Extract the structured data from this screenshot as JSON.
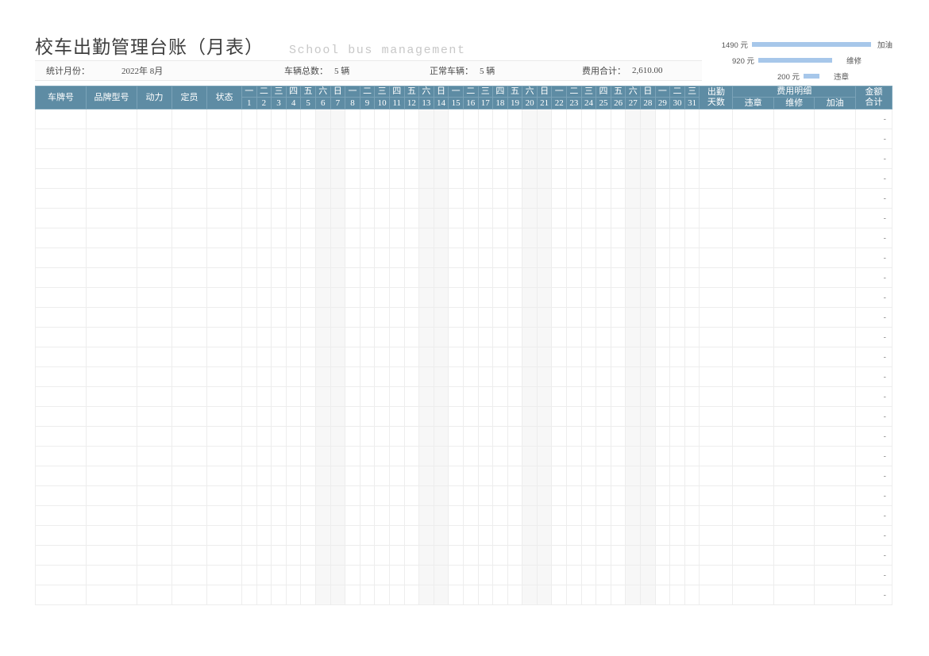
{
  "header": {
    "title_cn": "校车出勤管理台账（月表）",
    "title_en": "School bus management"
  },
  "stats": [
    {
      "label": "统计月份：",
      "value": "2022年 8月"
    },
    {
      "label": "车辆总数：",
      "value": "5 辆"
    },
    {
      "label": "正常车辆：",
      "value": "5 辆"
    },
    {
      "label": "费用合计：",
      "value": "2,610.00"
    }
  ],
  "chart_data": {
    "type": "bar",
    "title": "",
    "orientation": "horizontal",
    "categories": [
      "加油",
      "维修",
      "违章"
    ],
    "values": [
      1490,
      920,
      200
    ],
    "value_labels": [
      "1490 元",
      "920 元",
      "200 元"
    ],
    "unit": "元",
    "xlabel": "",
    "ylabel": "",
    "xlim": [
      0,
      1490
    ],
    "grid": false,
    "legend_position": "right",
    "bar_color": "#a7c7ea"
  },
  "table": {
    "left_columns": [
      "车牌号",
      "品牌型号",
      "动力",
      "定员",
      "状态"
    ],
    "days": [
      {
        "dow": "一",
        "num": "1",
        "weekend": false
      },
      {
        "dow": "二",
        "num": "2",
        "weekend": false
      },
      {
        "dow": "三",
        "num": "3",
        "weekend": false
      },
      {
        "dow": "四",
        "num": "4",
        "weekend": false
      },
      {
        "dow": "五",
        "num": "5",
        "weekend": false
      },
      {
        "dow": "六",
        "num": "6",
        "weekend": true
      },
      {
        "dow": "日",
        "num": "7",
        "weekend": true
      },
      {
        "dow": "一",
        "num": "8",
        "weekend": false
      },
      {
        "dow": "二",
        "num": "9",
        "weekend": false
      },
      {
        "dow": "三",
        "num": "10",
        "weekend": false
      },
      {
        "dow": "四",
        "num": "11",
        "weekend": false
      },
      {
        "dow": "五",
        "num": "12",
        "weekend": false
      },
      {
        "dow": "六",
        "num": "13",
        "weekend": true
      },
      {
        "dow": "日",
        "num": "14",
        "weekend": true
      },
      {
        "dow": "一",
        "num": "15",
        "weekend": false
      },
      {
        "dow": "二",
        "num": "16",
        "weekend": false
      },
      {
        "dow": "三",
        "num": "17",
        "weekend": false
      },
      {
        "dow": "四",
        "num": "18",
        "weekend": false
      },
      {
        "dow": "五",
        "num": "19",
        "weekend": false
      },
      {
        "dow": "六",
        "num": "20",
        "weekend": true
      },
      {
        "dow": "日",
        "num": "21",
        "weekend": true
      },
      {
        "dow": "一",
        "num": "22",
        "weekend": false
      },
      {
        "dow": "二",
        "num": "23",
        "weekend": false
      },
      {
        "dow": "三",
        "num": "24",
        "weekend": false
      },
      {
        "dow": "四",
        "num": "25",
        "weekend": false
      },
      {
        "dow": "五",
        "num": "26",
        "weekend": false
      },
      {
        "dow": "六",
        "num": "27",
        "weekend": true
      },
      {
        "dow": "日",
        "num": "28",
        "weekend": true
      },
      {
        "dow": "一",
        "num": "29",
        "weekend": false
      },
      {
        "dow": "二",
        "num": "30",
        "weekend": false
      },
      {
        "dow": "三",
        "num": "31",
        "weekend": false
      }
    ],
    "attendance_header": "出勤\n天数",
    "attendance_header_line1": "出勤",
    "attendance_header_line2": "天数",
    "expense_group_header": "费用明细",
    "expense_sub_headers": [
      "违章",
      "维修",
      "加油"
    ],
    "total_header_line1": "金额",
    "total_header_line2": "合计",
    "row_count": 25,
    "empty_total_placeholder": "-",
    "rows": []
  }
}
